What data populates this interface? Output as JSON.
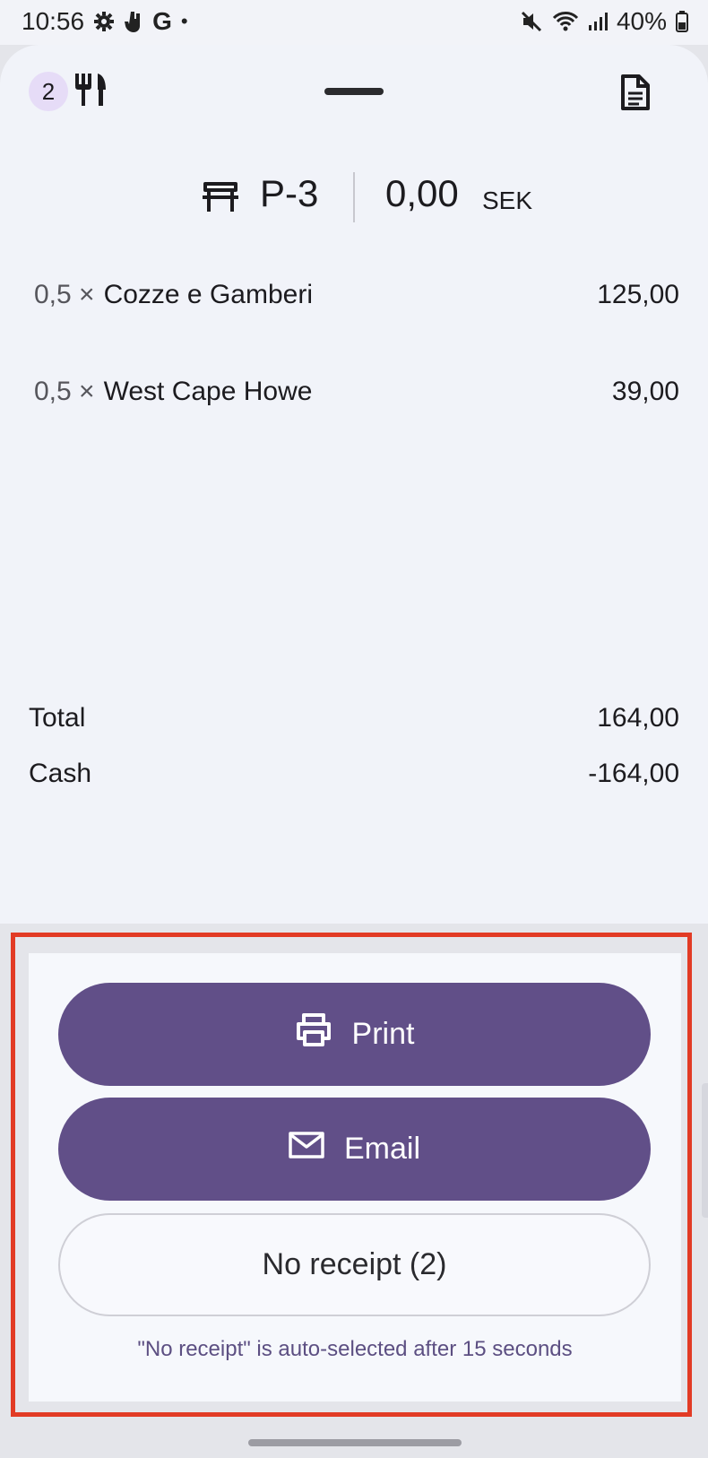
{
  "status_bar": {
    "time": "10:56",
    "google_letter": "G",
    "dot": "•",
    "battery_text": "40%",
    "icons": [
      "gear-icon",
      "hand-icon",
      "google-icon",
      "mute-icon",
      "wifi-icon",
      "signal-icon",
      "battery-icon"
    ]
  },
  "header": {
    "badge_count": "2",
    "icons": [
      "cutlery-icon",
      "document-icon"
    ]
  },
  "order": {
    "table_name": "P-3",
    "amount": "0,00",
    "currency": "SEK",
    "items": [
      {
        "qty": "0,5 ×",
        "name": "Cozze e Gamberi",
        "price": "125,00"
      },
      {
        "qty": "0,5 ×",
        "name": "West Cape Howe",
        "price": "39,00"
      }
    ],
    "summary": [
      {
        "label": "Total",
        "value": "164,00"
      },
      {
        "label": "Cash",
        "value": "-164,00"
      }
    ]
  },
  "receipt": {
    "print_label": "Print",
    "email_label": "Email",
    "no_receipt_label": "No receipt (2)",
    "hint": "\"No receipt\" is auto-selected after 15 seconds"
  },
  "colors": {
    "primary": "#614f88",
    "highlight_border": "#e23b25",
    "sheet_bg": "#f1f3f9",
    "badge_bg": "#e6dcf7"
  }
}
